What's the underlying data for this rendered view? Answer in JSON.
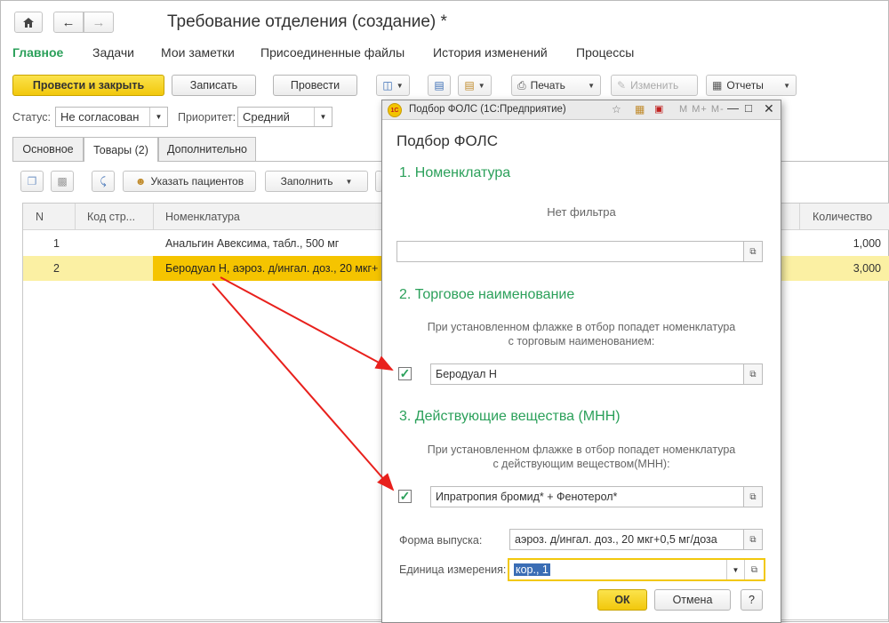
{
  "window": {
    "title": "Требование отделения (создание) *"
  },
  "menu": [
    "Главное",
    "Задачи",
    "Мои заметки",
    "Присоединенные файлы",
    "История изменений",
    "Процессы"
  ],
  "toolbar": {
    "post_close": "Провести и закрыть",
    "save": "Записать",
    "post": "Провести",
    "print": "Печать",
    "edit": "Изменить",
    "reports": "Отчеты"
  },
  "status": {
    "label": "Статус:",
    "value": "Не согласован"
  },
  "priority": {
    "label": "Приоритет:",
    "value": "Средний"
  },
  "tabs": [
    "Основное",
    "Товары (2)",
    "Дополнительно"
  ],
  "grid_toolbar": {
    "patients": "Указать пациентов",
    "fill": "Заполнить"
  },
  "table": {
    "headers": {
      "n": "N",
      "code": "Код стр...",
      "nom": "Номенклатура",
      "qty": "Количество"
    },
    "rows": [
      {
        "n": "1",
        "nom": "Анальгин Авексима, табл., 500 мг",
        "qty": "1,000"
      },
      {
        "n": "2",
        "nom": "Беродуал Н, аэроз. д/ингал. доз., 20 мкг+",
        "qty": "3,000"
      }
    ]
  },
  "dialog": {
    "title": "Подбор ФОЛС  (1С:Предприятие)",
    "heading": "Подбор ФОЛС",
    "title_icons": "M M+ M-",
    "sec1": "1. Номенклатура",
    "no_filter": "Нет фильтра",
    "sec2": "2. Торговое наименование",
    "note2_l1": "При установленном флажке в отбор попадет номенклатура",
    "note2_l2": "с торговым наименованием:",
    "trade_name": "Беродуал Н",
    "sec3": "3. Действующие вещества (МНН)",
    "note3_l1": "При установленном флажке в отбор попадет номенклатура",
    "note3_l2": "с действующим веществом(МНН):",
    "substances": "Ипратропия бромид* + Фенотерол*",
    "form_label": "Форма выпуска:",
    "form_value": "аэроз. д/ингал. доз., 20 мкг+0,5 мг/доза",
    "unit_label": "Единица измерения:",
    "unit_value": "кор., 1",
    "ok": "ОК",
    "cancel": "Отмена",
    "help": "?"
  },
  "colors": {
    "accent": "#2ba05a",
    "primary": "#f2c80c",
    "selected_row": "#fbf0a3",
    "selected_cell": "#f5c400",
    "arrow": "#e8201c"
  }
}
